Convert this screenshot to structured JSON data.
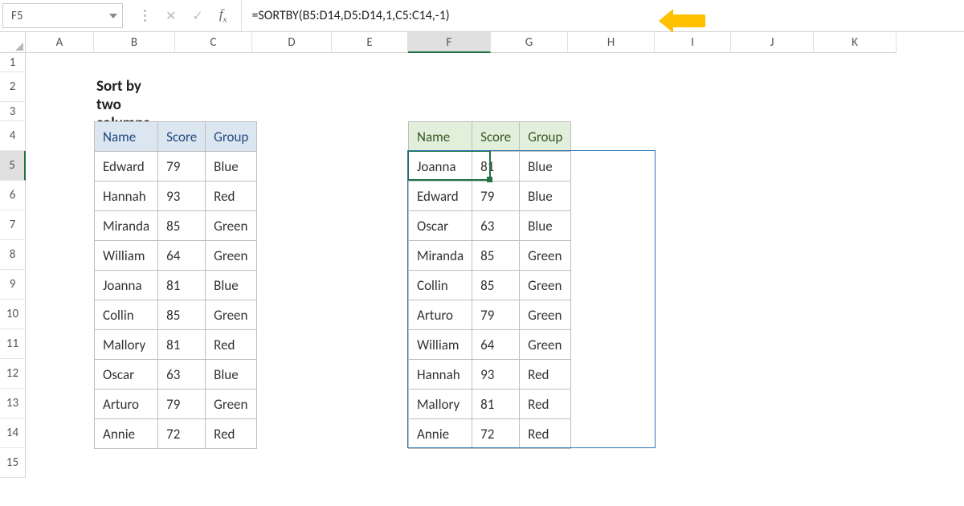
{
  "nameBox": "F5",
  "formula": "=SORTBY(B5:D14,D5:D14,1,C5:C14,-1)",
  "title": "Sort by two columns",
  "columns": [
    "A",
    "B",
    "C",
    "D",
    "E",
    "F",
    "G",
    "H",
    "I",
    "J",
    "K"
  ],
  "rows": [
    "1",
    "2",
    "3",
    "4",
    "5",
    "6",
    "7",
    "8",
    "9",
    "10",
    "11",
    "12",
    "13",
    "14",
    "15"
  ],
  "leftTable": {
    "headers": [
      "Name",
      "Score",
      "Group"
    ],
    "rows": [
      [
        "Edward",
        "79",
        "Blue"
      ],
      [
        "Hannah",
        "93",
        "Red"
      ],
      [
        "Miranda",
        "85",
        "Green"
      ],
      [
        "William",
        "64",
        "Green"
      ],
      [
        "Joanna",
        "81",
        "Blue"
      ],
      [
        "Collin",
        "85",
        "Green"
      ],
      [
        "Mallory",
        "81",
        "Red"
      ],
      [
        "Oscar",
        "63",
        "Blue"
      ],
      [
        "Arturo",
        "79",
        "Green"
      ],
      [
        "Annie",
        "72",
        "Red"
      ]
    ]
  },
  "rightTable": {
    "headers": [
      "Name",
      "Score",
      "Group"
    ],
    "rows": [
      [
        "Joanna",
        "81",
        "Blue"
      ],
      [
        "Edward",
        "79",
        "Blue"
      ],
      [
        "Oscar",
        "63",
        "Blue"
      ],
      [
        "Miranda",
        "85",
        "Green"
      ],
      [
        "Collin",
        "85",
        "Green"
      ],
      [
        "Arturo",
        "79",
        "Green"
      ],
      [
        "William",
        "64",
        "Green"
      ],
      [
        "Hannah",
        "93",
        "Red"
      ],
      [
        "Mallory",
        "81",
        "Red"
      ],
      [
        "Annie",
        "72",
        "Red"
      ]
    ]
  },
  "activeCol": "F",
  "activeRow": "5"
}
